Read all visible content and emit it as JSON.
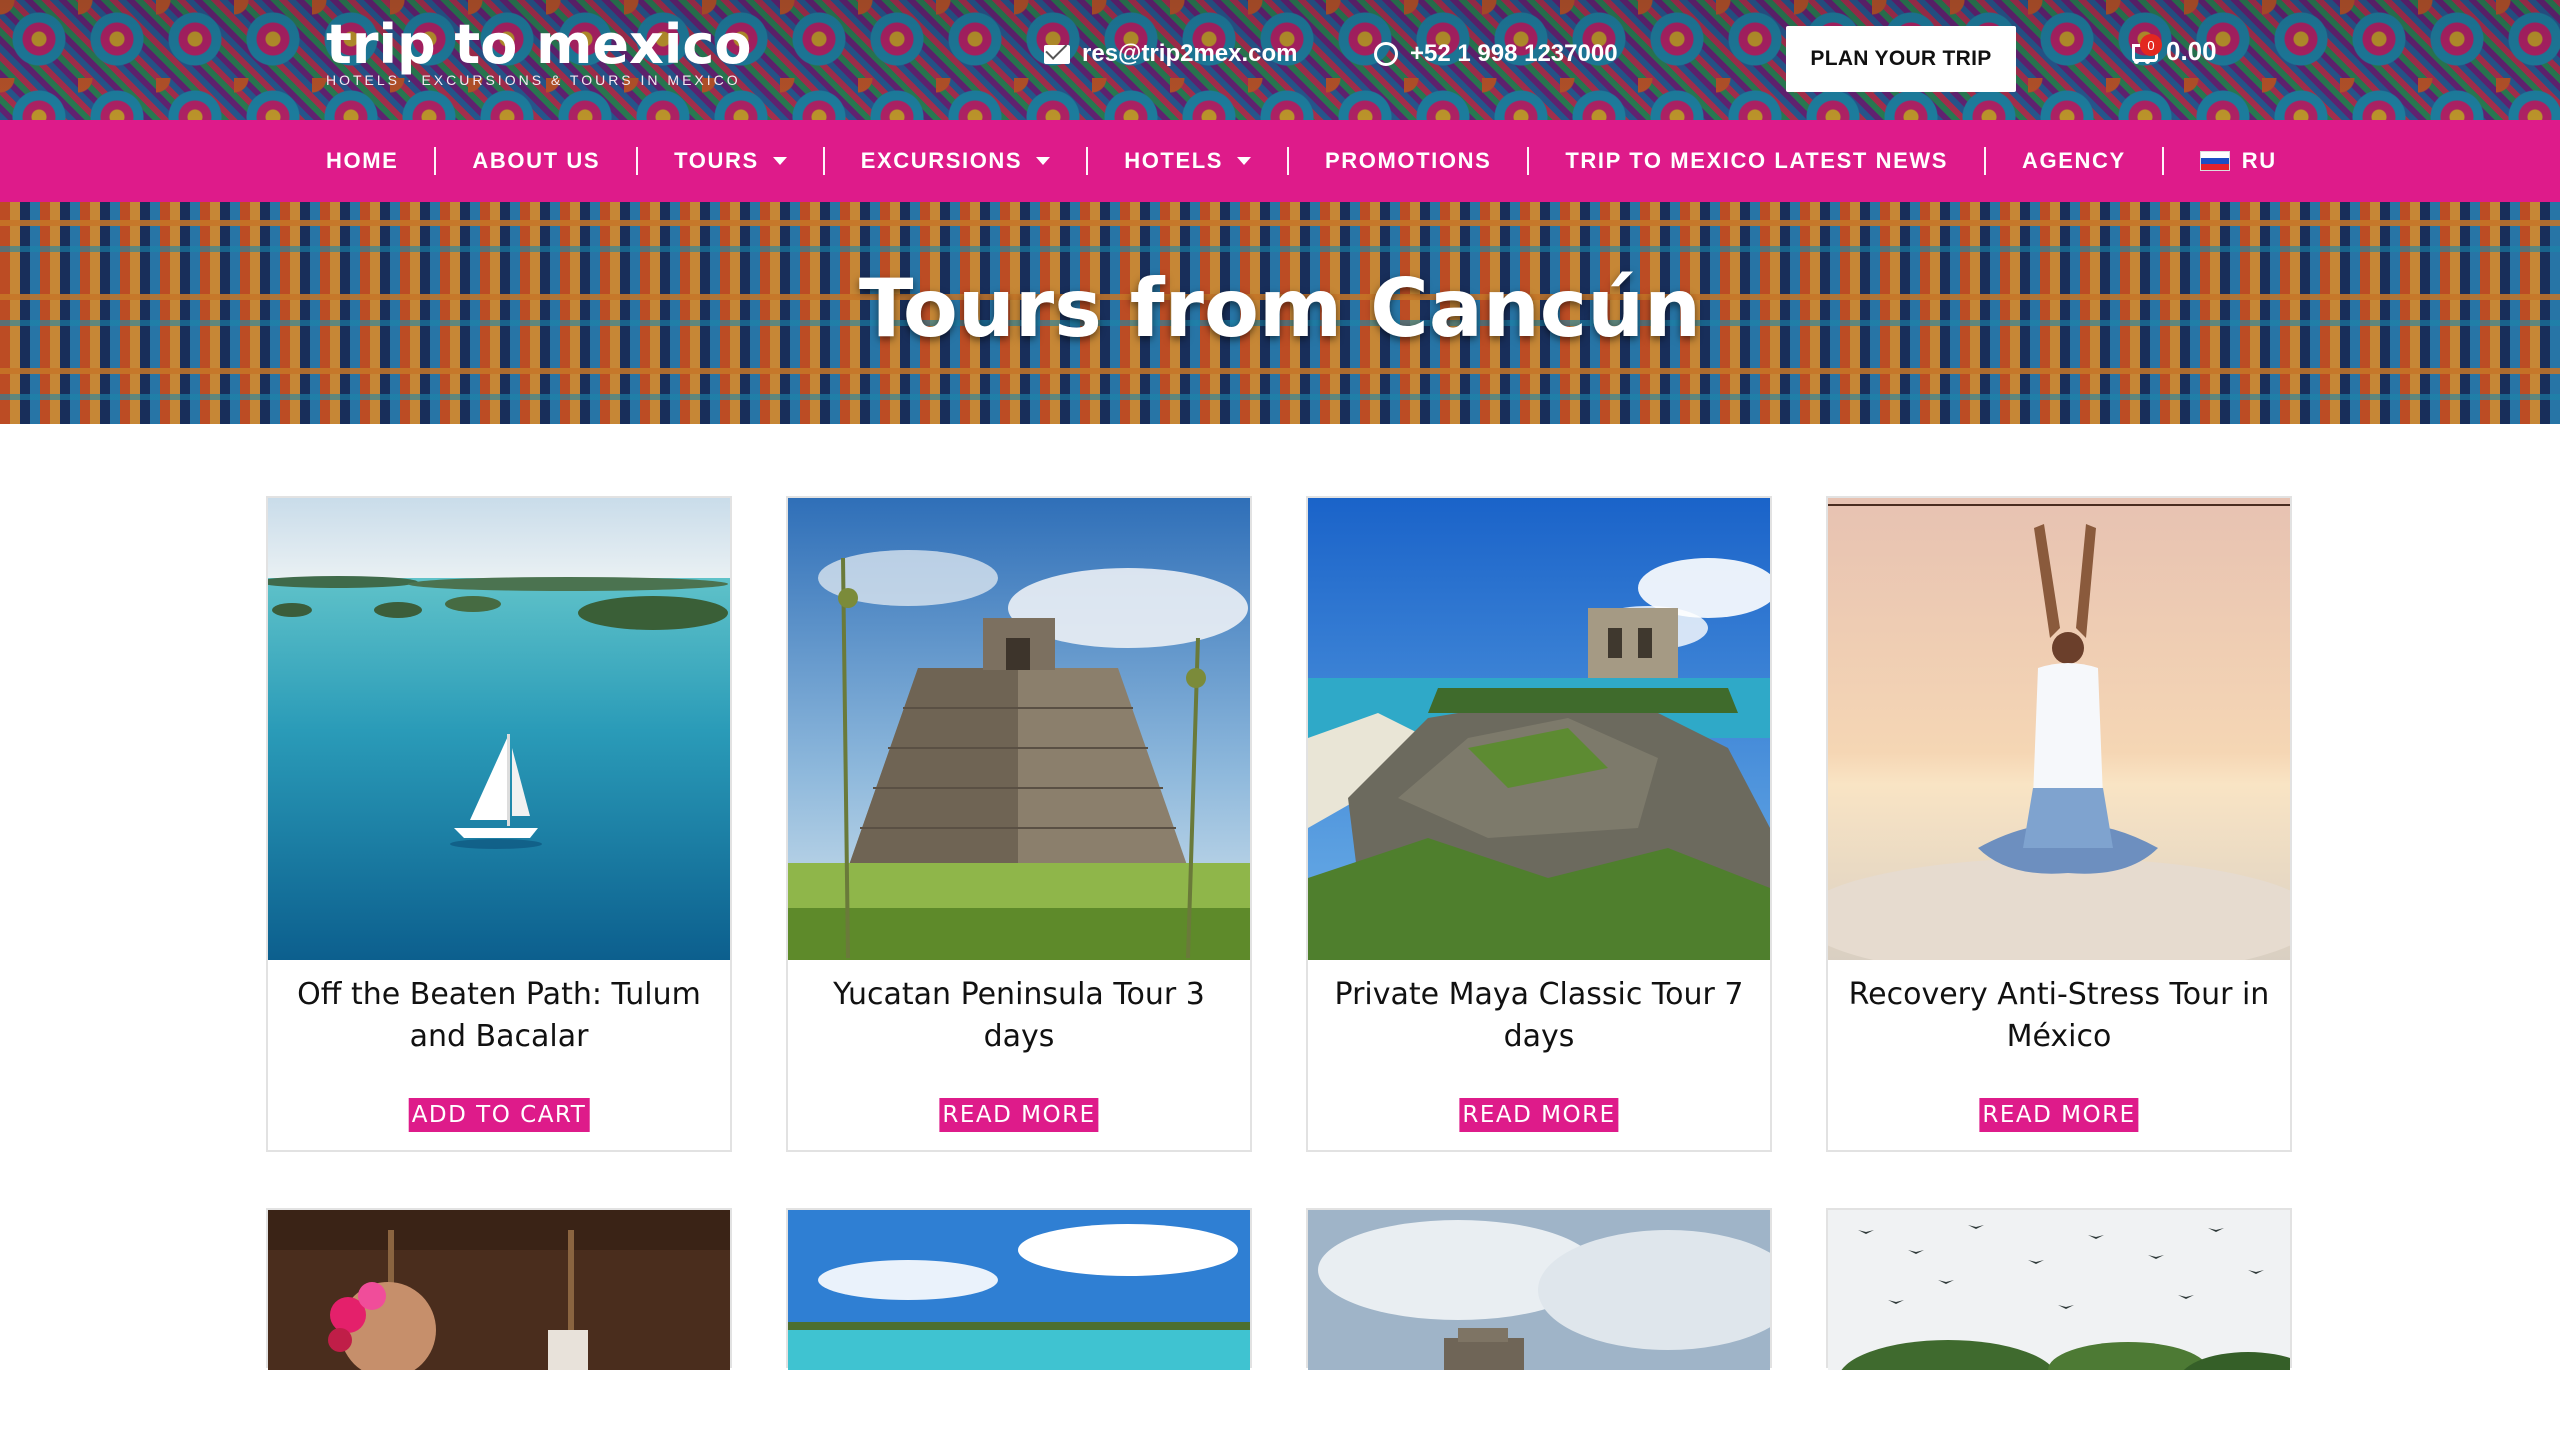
{
  "header": {
    "logo_text": "trip to mexico",
    "logo_tagline": "HOTELS · EXCURSIONS & TOURS IN MEXICO",
    "email": "res@trip2mex.com",
    "phone": "+52 1 998 1237000",
    "plan_button": "PLAN YOUR TRIP",
    "cart_count": "0",
    "cart_total": "0.00"
  },
  "nav": {
    "items": [
      {
        "label": "HOME"
      },
      {
        "label": "ABOUT US"
      },
      {
        "label": "TOURS"
      },
      {
        "label": "EXCURSIONS"
      },
      {
        "label": "HOTELS"
      },
      {
        "label": "PROMOTIONS"
      },
      {
        "label": "TRIP TO MEXICO LATEST NEWS"
      },
      {
        "label": "AGENCY"
      },
      {
        "label": "RU"
      }
    ]
  },
  "hero": {
    "title": "Tours from Cancún"
  },
  "products": [
    {
      "title": "Off the Beaten Path: Tulum and Bacalar",
      "button": "ADD TO CART"
    },
    {
      "title": "Yucatan Peninsula Tour 3 days",
      "button": "READ MORE"
    },
    {
      "title": "Private Maya Classic Tour 7 days",
      "button": "READ MORE"
    },
    {
      "title": "Recovery Anti-Stress Tour in México",
      "button": "READ MORE"
    }
  ],
  "colors": {
    "brand_pink": "#de1b8a",
    "white": "#ffffff"
  }
}
